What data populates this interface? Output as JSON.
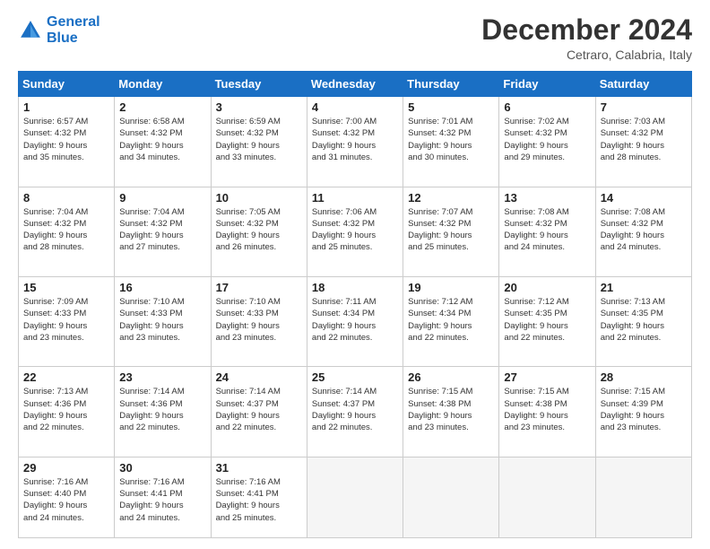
{
  "logo": {
    "line1": "General",
    "line2": "Blue"
  },
  "title": "December 2024",
  "location": "Cetraro, Calabria, Italy",
  "days_header": [
    "Sunday",
    "Monday",
    "Tuesday",
    "Wednesday",
    "Thursday",
    "Friday",
    "Saturday"
  ],
  "weeks": [
    [
      {
        "num": "1",
        "info": "Sunrise: 6:57 AM\nSunset: 4:32 PM\nDaylight: 9 hours\nand 35 minutes."
      },
      {
        "num": "2",
        "info": "Sunrise: 6:58 AM\nSunset: 4:32 PM\nDaylight: 9 hours\nand 34 minutes."
      },
      {
        "num": "3",
        "info": "Sunrise: 6:59 AM\nSunset: 4:32 PM\nDaylight: 9 hours\nand 33 minutes."
      },
      {
        "num": "4",
        "info": "Sunrise: 7:00 AM\nSunset: 4:32 PM\nDaylight: 9 hours\nand 31 minutes."
      },
      {
        "num": "5",
        "info": "Sunrise: 7:01 AM\nSunset: 4:32 PM\nDaylight: 9 hours\nand 30 minutes."
      },
      {
        "num": "6",
        "info": "Sunrise: 7:02 AM\nSunset: 4:32 PM\nDaylight: 9 hours\nand 29 minutes."
      },
      {
        "num": "7",
        "info": "Sunrise: 7:03 AM\nSunset: 4:32 PM\nDaylight: 9 hours\nand 28 minutes."
      }
    ],
    [
      {
        "num": "8",
        "info": "Sunrise: 7:04 AM\nSunset: 4:32 PM\nDaylight: 9 hours\nand 28 minutes."
      },
      {
        "num": "9",
        "info": "Sunrise: 7:04 AM\nSunset: 4:32 PM\nDaylight: 9 hours\nand 27 minutes."
      },
      {
        "num": "10",
        "info": "Sunrise: 7:05 AM\nSunset: 4:32 PM\nDaylight: 9 hours\nand 26 minutes."
      },
      {
        "num": "11",
        "info": "Sunrise: 7:06 AM\nSunset: 4:32 PM\nDaylight: 9 hours\nand 25 minutes."
      },
      {
        "num": "12",
        "info": "Sunrise: 7:07 AM\nSunset: 4:32 PM\nDaylight: 9 hours\nand 25 minutes."
      },
      {
        "num": "13",
        "info": "Sunrise: 7:08 AM\nSunset: 4:32 PM\nDaylight: 9 hours\nand 24 minutes."
      },
      {
        "num": "14",
        "info": "Sunrise: 7:08 AM\nSunset: 4:32 PM\nDaylight: 9 hours\nand 24 minutes."
      }
    ],
    [
      {
        "num": "15",
        "info": "Sunrise: 7:09 AM\nSunset: 4:33 PM\nDaylight: 9 hours\nand 23 minutes."
      },
      {
        "num": "16",
        "info": "Sunrise: 7:10 AM\nSunset: 4:33 PM\nDaylight: 9 hours\nand 23 minutes."
      },
      {
        "num": "17",
        "info": "Sunrise: 7:10 AM\nSunset: 4:33 PM\nDaylight: 9 hours\nand 23 minutes."
      },
      {
        "num": "18",
        "info": "Sunrise: 7:11 AM\nSunset: 4:34 PM\nDaylight: 9 hours\nand 22 minutes."
      },
      {
        "num": "19",
        "info": "Sunrise: 7:12 AM\nSunset: 4:34 PM\nDaylight: 9 hours\nand 22 minutes."
      },
      {
        "num": "20",
        "info": "Sunrise: 7:12 AM\nSunset: 4:35 PM\nDaylight: 9 hours\nand 22 minutes."
      },
      {
        "num": "21",
        "info": "Sunrise: 7:13 AM\nSunset: 4:35 PM\nDaylight: 9 hours\nand 22 minutes."
      }
    ],
    [
      {
        "num": "22",
        "info": "Sunrise: 7:13 AM\nSunset: 4:36 PM\nDaylight: 9 hours\nand 22 minutes."
      },
      {
        "num": "23",
        "info": "Sunrise: 7:14 AM\nSunset: 4:36 PM\nDaylight: 9 hours\nand 22 minutes."
      },
      {
        "num": "24",
        "info": "Sunrise: 7:14 AM\nSunset: 4:37 PM\nDaylight: 9 hours\nand 22 minutes."
      },
      {
        "num": "25",
        "info": "Sunrise: 7:14 AM\nSunset: 4:37 PM\nDaylight: 9 hours\nand 22 minutes."
      },
      {
        "num": "26",
        "info": "Sunrise: 7:15 AM\nSunset: 4:38 PM\nDaylight: 9 hours\nand 23 minutes."
      },
      {
        "num": "27",
        "info": "Sunrise: 7:15 AM\nSunset: 4:38 PM\nDaylight: 9 hours\nand 23 minutes."
      },
      {
        "num": "28",
        "info": "Sunrise: 7:15 AM\nSunset: 4:39 PM\nDaylight: 9 hours\nand 23 minutes."
      }
    ],
    [
      {
        "num": "29",
        "info": "Sunrise: 7:16 AM\nSunset: 4:40 PM\nDaylight: 9 hours\nand 24 minutes."
      },
      {
        "num": "30",
        "info": "Sunrise: 7:16 AM\nSunset: 4:41 PM\nDaylight: 9 hours\nand 24 minutes."
      },
      {
        "num": "31",
        "info": "Sunrise: 7:16 AM\nSunset: 4:41 PM\nDaylight: 9 hours\nand 25 minutes."
      },
      null,
      null,
      null,
      null
    ]
  ]
}
